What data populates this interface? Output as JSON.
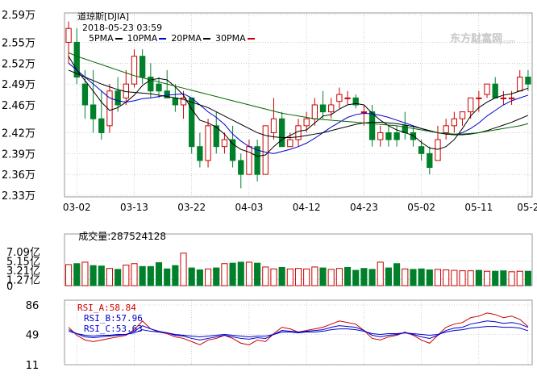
{
  "header": {
    "symbol": "道琼斯[DJIA]",
    "datetime": "2018-05-23 03:59",
    "ma_legend": [
      {
        "label": "5PMA",
        "color": "#000000"
      },
      {
        "label": "10PMA",
        "color": "#0000cc"
      },
      {
        "label": "20PMA",
        "color": "#000000"
      },
      {
        "label": "30PMA",
        "color": "#cc0000"
      }
    ],
    "watermark": "东方财富网",
    "watermark_sub": "eastmoney.com"
  },
  "colors": {
    "up": "#cc0000",
    "down": "#00802b",
    "ma5": "#000000",
    "ma10": "#0000cc",
    "ma20": "#000000",
    "ma30": "#006600",
    "grid": "#b0b0b0",
    "axis_text": "#000000"
  },
  "volume_header": {
    "label": "成交量:",
    "value": "287524128"
  },
  "rsi_header": {
    "a_label": "RSI_A:",
    "a_value": "58.84",
    "b_label": "RSI_B:",
    "b_value": "57.96",
    "c_label": "RSI_C:",
    "c_value": "53.63"
  },
  "chart_data": [
    {
      "type": "candlestick",
      "title": "道琼斯[DJIA] 2018-05-23 03:59",
      "x_tick_labels": [
        "03-02",
        "03-13",
        "03-22",
        "04-03",
        "04-12",
        "04-23",
        "05-02",
        "05-11",
        "05-2"
      ],
      "x_tick_indices": [
        1,
        8,
        15,
        22,
        29,
        36,
        43,
        50,
        56
      ],
      "y_tick_labels": [
        "2.59万",
        "2.55万",
        "2.52万",
        "2.49万",
        "2.46万",
        "2.42万",
        "2.39万",
        "2.36万",
        "2.33万"
      ],
      "ylim": [
        23300,
        25900
      ],
      "candles": [
        {
          "o": 25500,
          "h": 25800,
          "l": 25200,
          "c": 25700
        },
        {
          "o": 25500,
          "h": 25700,
          "l": 24900,
          "c": 25000
        },
        {
          "o": 24900,
          "h": 25100,
          "l": 24400,
          "c": 24600
        },
        {
          "o": 24600,
          "h": 25100,
          "l": 24200,
          "c": 24400
        },
        {
          "o": 24400,
          "h": 24800,
          "l": 24100,
          "c": 24200
        },
        {
          "o": 24300,
          "h": 24900,
          "l": 24200,
          "c": 24800
        },
        {
          "o": 24800,
          "h": 25000,
          "l": 24500,
          "c": 24600
        },
        {
          "o": 24700,
          "h": 25100,
          "l": 24600,
          "c": 24900
        },
        {
          "o": 24900,
          "h": 25400,
          "l": 24850,
          "c": 25300
        },
        {
          "o": 25300,
          "h": 25400,
          "l": 24900,
          "c": 25000
        },
        {
          "o": 25000,
          "h": 25200,
          "l": 24700,
          "c": 24800
        },
        {
          "o": 24900,
          "h": 25000,
          "l": 24700,
          "c": 24800
        },
        {
          "o": 24800,
          "h": 25100,
          "l": 24700,
          "c": 24700
        },
        {
          "o": 24700,
          "h": 24900,
          "l": 24500,
          "c": 24600
        },
        {
          "o": 24600,
          "h": 24800,
          "l": 24400,
          "c": 24700
        },
        {
          "o": 24700,
          "h": 24700,
          "l": 23900,
          "c": 24000
        },
        {
          "o": 24000,
          "h": 24200,
          "l": 23700,
          "c": 23800
        },
        {
          "o": 23800,
          "h": 24400,
          "l": 23700,
          "c": 24300
        },
        {
          "o": 24300,
          "h": 24500,
          "l": 23900,
          "c": 24000
        },
        {
          "o": 24000,
          "h": 24200,
          "l": 23900,
          "c": 24100
        },
        {
          "o": 24100,
          "h": 24300,
          "l": 23700,
          "c": 23800
        },
        {
          "o": 23800,
          "h": 23900,
          "l": 23400,
          "c": 23600
        },
        {
          "o": 23600,
          "h": 24100,
          "l": 23600,
          "c": 24000
        },
        {
          "o": 24000,
          "h": 24100,
          "l": 23500,
          "c": 23600
        },
        {
          "o": 23600,
          "h": 24300,
          "l": 23600,
          "c": 24300
        },
        {
          "o": 24200,
          "h": 24700,
          "l": 24100,
          "c": 24400
        },
        {
          "o": 24400,
          "h": 24500,
          "l": 24000,
          "c": 24000
        },
        {
          "o": 24000,
          "h": 24200,
          "l": 24000,
          "c": 24100
        },
        {
          "o": 24100,
          "h": 24400,
          "l": 24000,
          "c": 24300
        },
        {
          "o": 24300,
          "h": 24500,
          "l": 24200,
          "c": 24400
        },
        {
          "o": 24400,
          "h": 24700,
          "l": 24300,
          "c": 24600
        },
        {
          "o": 24600,
          "h": 24800,
          "l": 24400,
          "c": 24500
        },
        {
          "o": 24500,
          "h": 24700,
          "l": 24400,
          "c": 24600
        },
        {
          "o": 24650,
          "h": 24850,
          "l": 24550,
          "c": 24750
        },
        {
          "o": 24700,
          "h": 24800,
          "l": 24600,
          "c": 24700
        },
        {
          "o": 24700,
          "h": 24750,
          "l": 24550,
          "c": 24600
        },
        {
          "o": 24500,
          "h": 24600,
          "l": 24300,
          "c": 24500
        },
        {
          "o": 24500,
          "h": 24600,
          "l": 24000,
          "c": 24100
        },
        {
          "o": 24100,
          "h": 24300,
          "l": 24000,
          "c": 24200
        },
        {
          "o": 24200,
          "h": 24300,
          "l": 24000,
          "c": 24100
        },
        {
          "o": 24200,
          "h": 24300,
          "l": 24000,
          "c": 24100
        },
        {
          "o": 24300,
          "h": 24500,
          "l": 24100,
          "c": 24200
        },
        {
          "o": 24200,
          "h": 24300,
          "l": 24000,
          "c": 24100
        },
        {
          "o": 24000,
          "h": 24100,
          "l": 23800,
          "c": 23900
        },
        {
          "o": 23900,
          "h": 24000,
          "l": 23600,
          "c": 23700
        },
        {
          "o": 23800,
          "h": 24300,
          "l": 23800,
          "c": 24100
        },
        {
          "o": 24200,
          "h": 24400,
          "l": 24100,
          "c": 24300
        },
        {
          "o": 24300,
          "h": 24500,
          "l": 24200,
          "c": 24400
        },
        {
          "o": 24400,
          "h": 24500,
          "l": 24300,
          "c": 24500
        },
        {
          "o": 24500,
          "h": 24700,
          "l": 24400,
          "c": 24700
        },
        {
          "o": 24700,
          "h": 24800,
          "l": 24500,
          "c": 24700
        },
        {
          "o": 24750,
          "h": 24900,
          "l": 24700,
          "c": 24900
        },
        {
          "o": 24900,
          "h": 25000,
          "l": 24700,
          "c": 24700
        },
        {
          "o": 24700,
          "h": 24800,
          "l": 24600,
          "c": 24700
        },
        {
          "o": 24700,
          "h": 24800,
          "l": 24600,
          "c": 24700
        },
        {
          "o": 24800,
          "h": 25100,
          "l": 24800,
          "c": 25000
        },
        {
          "o": 25000,
          "h": 25100,
          "l": 24800,
          "c": 24900
        }
      ],
      "ma_series": [
        {
          "name": "5PMA",
          "color": "#000000",
          "values": [
            25300,
            25100,
            24950,
            24800,
            24640,
            24520,
            24560,
            24640,
            24740,
            24880,
            24960,
            24980,
            24960,
            24860,
            24740,
            24540,
            24380,
            24340,
            24280,
            24180,
            24040,
            23960,
            23920,
            23860,
            23880,
            24000,
            24100,
            24160,
            24220,
            24240,
            24340,
            24440,
            24460,
            24540,
            24600,
            24620,
            24600,
            24480,
            24380,
            24300,
            24240,
            24200,
            24160,
            24060,
            23980,
            23960,
            24000,
            24100,
            24260,
            24440,
            24560,
            24640,
            24700,
            24740,
            24760,
            24800,
            24840
          ]
        },
        {
          "name": "10PMA",
          "color": "#0000cc",
          "values": [
            25200,
            25100,
            25000,
            24900,
            24800,
            24700,
            24660,
            24640,
            24660,
            24690,
            24700,
            24720,
            24740,
            24750,
            24760,
            24700,
            24600,
            24500,
            24420,
            24320,
            24180,
            24080,
            24000,
            23950,
            23920,
            23900,
            23930,
            23960,
            24000,
            24050,
            24120,
            24200,
            24280,
            24350,
            24420,
            24460,
            24480,
            24470,
            24450,
            24420,
            24380,
            24340,
            24300,
            24260,
            24220,
            24200,
            24180,
            24170,
            24200,
            24260,
            24340,
            24440,
            24520,
            24600,
            24660,
            24700,
            24740
          ]
        },
        {
          "name": "20PMA",
          "color": "#000000",
          "values": [
            25100,
            25050,
            25000,
            24950,
            24900,
            24860,
            24820,
            24790,
            24780,
            24770,
            24760,
            24740,
            24720,
            24700,
            24680,
            24640,
            24600,
            24560,
            24500,
            24440,
            24380,
            24320,
            24260,
            24200,
            24160,
            24140,
            24130,
            24130,
            24140,
            24160,
            24180,
            24200,
            24230,
            24260,
            24290,
            24320,
            24340,
            24350,
            24350,
            24340,
            24330,
            24310,
            24290,
            24260,
            24230,
            24200,
            24180,
            24170,
            24170,
            24180,
            24200,
            24230,
            24270,
            24310,
            24350,
            24400,
            24450
          ]
        },
        {
          "name": "30PMA",
          "color": "#006600",
          "values": [
            25350,
            25300,
            25260,
            25220,
            25180,
            25140,
            25100,
            25060,
            25020,
            24990,
            24960,
            24930,
            24900,
            24870,
            24840,
            24810,
            24780,
            24750,
            24720,
            24690,
            24660,
            24630,
            24600,
            24570,
            24540,
            24510,
            24480,
            24460,
            24440,
            24420,
            24400,
            24390,
            24380,
            24370,
            24360,
            24350,
            24340,
            24330,
            24320,
            24310,
            24300,
            24280,
            24260,
            24240,
            24220,
            24200,
            24190,
            24180,
            24180,
            24190,
            24200,
            24220,
            24240,
            24260,
            24280,
            24300,
            24330
          ]
        }
      ]
    },
    {
      "type": "bar",
      "title": "成交量:287524128",
      "y_tick_labels": [
        "7.09亿",
        "5.15亿",
        "3.21亿",
        "1.27亿",
        "0"
      ],
      "ylim": [
        0,
        7.09
      ],
      "values": [
        4.4,
        4.6,
        4.9,
        4.2,
        4.1,
        3.6,
        3.4,
        4.3,
        4.6,
        4.0,
        4.0,
        4.8,
        3.5,
        4.2,
        6.8,
        3.7,
        3.3,
        3.5,
        3.7,
        4.6,
        4.7,
        4.9,
        4.9,
        4.7,
        3.9,
        3.5,
        3.8,
        3.5,
        3.6,
        3.5,
        3.9,
        3.7,
        3.4,
        3.6,
        3.8,
        3.2,
        3.6,
        3.4,
        4.9,
        3.7,
        4.6,
        3.5,
        3.4,
        3.5,
        3.3,
        3.4,
        3.3,
        3.2,
        3.1,
        3.1,
        3.2,
        3.0,
        3.0,
        3.1,
        2.9,
        3.0,
        3.0
      ],
      "up_down": [
        1,
        0,
        1,
        0,
        0,
        1,
        0,
        1,
        1,
        0,
        0,
        0,
        0,
        0,
        1,
        0,
        0,
        1,
        0,
        1,
        0,
        0,
        1,
        0,
        1,
        1,
        0,
        1,
        1,
        1,
        1,
        0,
        1,
        1,
        0,
        0,
        0,
        0,
        1,
        0,
        0,
        1,
        0,
        0,
        0,
        1,
        1,
        1,
        1,
        1,
        0,
        1,
        0,
        0,
        1,
        1,
        0
      ]
    },
    {
      "type": "line",
      "title": "RSI",
      "y_tick_labels": [
        "86",
        "49",
        "11"
      ],
      "ylim": [
        11,
        86
      ],
      "series": [
        {
          "name": "RSI_A",
          "color": "#cc0000",
          "values": [
            58,
            48,
            42,
            40,
            42,
            44,
            46,
            48,
            55,
            66,
            56,
            52,
            50,
            46,
            44,
            40,
            36,
            42,
            44,
            48,
            44,
            38,
            36,
            42,
            40,
            50,
            58,
            56,
            52,
            54,
            56,
            58,
            62,
            66,
            64,
            62,
            54,
            44,
            42,
            46,
            48,
            52,
            48,
            42,
            38,
            48,
            58,
            62,
            64,
            70,
            72,
            76,
            74,
            70,
            72,
            68,
            58.84
          ]
        },
        {
          "name": "RSI_B",
          "color": "#0000cc",
          "values": [
            55,
            50,
            46,
            45,
            46,
            47,
            48,
            49,
            53,
            60,
            56,
            53,
            51,
            48,
            47,
            44,
            42,
            44,
            46,
            48,
            46,
            44,
            43,
            45,
            44,
            49,
            54,
            53,
            52,
            53,
            54,
            55,
            58,
            60,
            59,
            58,
            54,
            48,
            46,
            48,
            49,
            51,
            49,
            46,
            44,
            48,
            54,
            57,
            58,
            62,
            64,
            66,
            65,
            63,
            64,
            62,
            57.96
          ]
        },
        {
          "name": "RSI_C",
          "color": "#0000cc",
          "values": [
            53,
            50,
            48,
            47,
            48,
            48,
            49,
            49,
            51,
            55,
            53,
            52,
            51,
            49,
            48,
            47,
            46,
            47,
            48,
            49,
            48,
            47,
            46,
            47,
            47,
            49,
            52,
            52,
            51,
            52,
            52,
            53,
            55,
            56,
            56,
            55,
            53,
            50,
            49,
            50,
            50,
            51,
            50,
            49,
            48,
            49,
            52,
            54,
            55,
            57,
            58,
            59,
            59,
            58,
            58,
            57,
            53.63
          ]
        }
      ]
    }
  ]
}
